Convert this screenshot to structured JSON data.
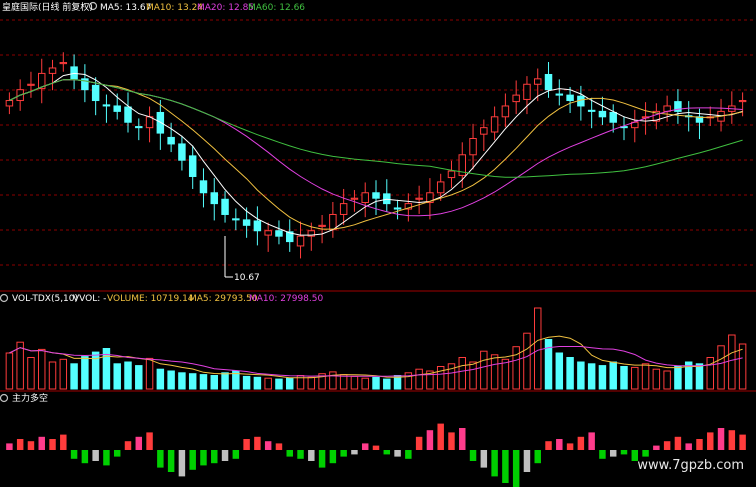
{
  "price_panel": {
    "title": "皇庭国际(日线 前复权)",
    "ma_labels": [
      {
        "text": "MA5: 13.67",
        "color": "#ffffff"
      },
      {
        "text": "MA10: 13.24",
        "color": "#f0c040"
      },
      {
        "text": "MA20: 12.85",
        "color": "#e040e0"
      },
      {
        "text": "MA60: 12.66",
        "color": "#40c040"
      }
    ],
    "low_annotation": "10.67"
  },
  "volume_panel": {
    "title": "VOL-TDX(5,10)",
    "labels": [
      {
        "text": "VVOL: -",
        "color": "#ffffff"
      },
      {
        "text": "VOLUME: 10719.14",
        "color": "#f0c040"
      },
      {
        "text": "MA5: 29793.50",
        "color": "#f0c040"
      },
      {
        "text": "MA10: 27998.50",
        "color": "#e040e0"
      }
    ]
  },
  "indicator_panel": {
    "title": "主力多空"
  },
  "watermark": "www.7gpzb.com",
  "colors": {
    "up": "#ff3c3c",
    "down": "#54ffff",
    "ma5": "#ffffff",
    "ma10": "#f0c040",
    "ma20": "#e040e0",
    "ma60": "#40c040",
    "grid": "#8b0000",
    "divider": "#a00000",
    "hist_up": "#ff3c3c",
    "hist_pink": "#ff3c8c",
    "hist_down": "#00d000",
    "hist_grey": "#c0c0c0"
  },
  "chart_data": [
    {
      "type": "candlestick",
      "title": "皇庭国际(日线 前复权)",
      "low_marked": 10.67,
      "ylim": [
        10.3,
        15.0
      ],
      "series": [
        {
          "name": "MA5",
          "last": 13.67
        },
        {
          "name": "MA10",
          "last": 13.24
        },
        {
          "name": "MA20",
          "last": 12.85
        },
        {
          "name": "MA60",
          "last": 12.66
        }
      ],
      "closes": [
        13.7,
        13.9,
        14.0,
        14.2,
        14.3,
        14.4,
        14.1,
        13.9,
        13.7,
        13.6,
        13.5,
        13.3,
        13.2,
        13.4,
        13.1,
        12.9,
        12.6,
        12.3,
        12.0,
        11.8,
        11.6,
        11.5,
        11.4,
        11.3,
        11.3,
        11.2,
        11.1,
        11.2,
        11.3,
        11.4,
        11.6,
        11.8,
        11.9,
        12.0,
        11.9,
        11.8,
        11.7,
        11.8,
        11.9,
        12.0,
        12.2,
        12.4,
        12.7,
        13.0,
        13.2,
        13.4,
        13.6,
        13.8,
        14.0,
        14.1,
        13.9,
        13.8,
        13.7,
        13.6,
        13.5,
        13.4,
        13.3,
        13.2,
        13.3,
        13.4,
        13.5,
        13.6,
        13.5,
        13.4,
        13.3,
        13.4,
        13.5,
        13.6,
        13.7
      ]
    },
    {
      "type": "bar",
      "title": "VOL-TDX(5,10)",
      "series": [
        {
          "name": "VOLUME",
          "last": 10719.14
        },
        {
          "name": "MA5",
          "last": 29793.5
        },
        {
          "name": "MA10",
          "last": 27998.5
        }
      ],
      "values": [
        40,
        52,
        35,
        44,
        30,
        33,
        28,
        36,
        41,
        45,
        28,
        30,
        26,
        34,
        22,
        20,
        18,
        17,
        16,
        15,
        18,
        20,
        14,
        13,
        12,
        11,
        12,
        15,
        13,
        17,
        19,
        16,
        14,
        12,
        13,
        11,
        15,
        18,
        22,
        20,
        25,
        28,
        35,
        30,
        42,
        38,
        33,
        47,
        62,
        90,
        55,
        40,
        35,
        30,
        28,
        26,
        30,
        25,
        24,
        28,
        22,
        20,
        25,
        30,
        28,
        35,
        48,
        60,
        50
      ]
    },
    {
      "type": "bar",
      "title": "主力多空",
      "values": [
        3,
        5,
        4,
        6,
        5,
        7,
        -4,
        -6,
        -5,
        -7,
        -3,
        4,
        6,
        8,
        -8,
        -10,
        -12,
        -9,
        -7,
        -6,
        -5,
        -4,
        5,
        6,
        4,
        3,
        -3,
        -4,
        -5,
        -8,
        -6,
        -3,
        -2,
        3,
        2,
        -2,
        -3,
        -4,
        6,
        9,
        12,
        8,
        10,
        -5,
        -8,
        -12,
        -15,
        -18,
        -10,
        -6,
        4,
        5,
        3,
        6,
        8,
        -4,
        -3,
        -2,
        -5,
        -3,
        2,
        4,
        6,
        3,
        5,
        8,
        10,
        9,
        7
      ]
    }
  ]
}
